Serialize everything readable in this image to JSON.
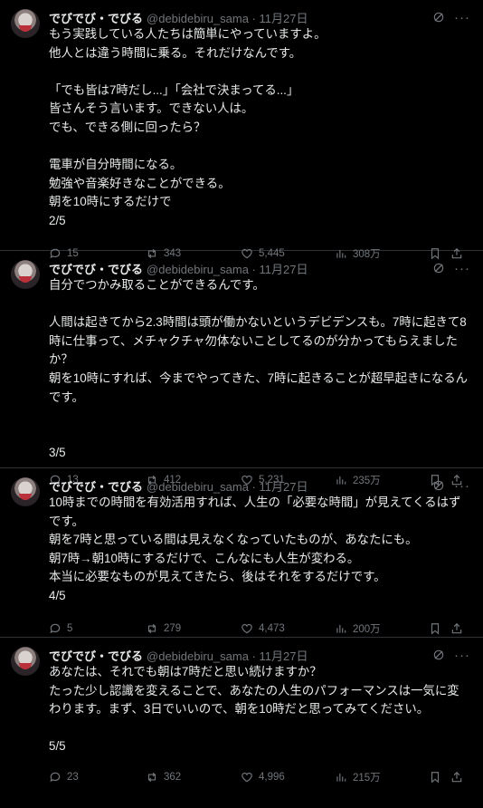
{
  "tweets": [
    {
      "author": "でびでび・でびる",
      "meta": "@debidebiru_sama · 11月27日",
      "text": "もう実践している人たちは簡単にやっていますよ。\n他人とは違う時間に乗る。それだけなんです。\n\n「でも皆は7時だし...」「会社で決まってる...」\n皆さんそう言います。できない人は。\nでも、できる側に回ったら？\n\n電車が自分時間になる。\n勉強や音楽好きなことができる。\n朝を10時にするだけで\n2/5",
      "replies": "15",
      "reposts": "343",
      "likes": "5,445",
      "views": "308万"
    },
    {
      "author": "でびでび・でびる",
      "meta": "@debidebiru_sama · 11月27日",
      "text": "自分でつかみ取ることができるんです。\n\n人間は起きてから2.3時間は頭が働かないというデビデンスも。7時に起きて8時に仕事って、メチャクチャ勿体ないことしてるのが分かってもらえましたか？\n朝を10時にすれば、今までやってきた、7時に起きることが超早起きになるんです。\n\n\n3/5",
      "replies": "13",
      "reposts": "412",
      "likes": "5,231",
      "views": "235万"
    },
    {
      "author": "でびでび・でびる",
      "meta": "@debidebiru_sama · 11月27日",
      "text": "10時までの時間を有効活用すれば、人生の「必要な時間」が見えてくるはずです。\n朝を7時と思っている間は見えなくなっていたものが、あなたにも。\n朝7時→朝10時にするだけで、こんなにも人生が変わる。\n本当に必要なものが見えてきたら、後はそれをするだけです。\n4/5",
      "replies": "5",
      "reposts": "279",
      "likes": "4,473",
      "views": "200万"
    },
    {
      "author": "でびでび・でびる",
      "meta": "@debidebiru_sama · 11月27日",
      "text": "あなたは、それでも朝は7時だと思い続けますか？\nたった少し認識を変えることで、あなたの人生のパフォーマンスは一気に変わります。まず、3日でいいので、朝を10時だと思ってみてください。\n\n5/5",
      "replies": "23",
      "reposts": "362",
      "likes": "4,996",
      "views": "215万"
    }
  ],
  "icons": {
    "more": "more-dots-icon",
    "grok": "grok-icon",
    "reply": "reply-icon",
    "repost": "repost-icon",
    "like": "heart-icon",
    "views": "views-icon",
    "bookmark": "bookmark-icon",
    "share": "share-icon"
  },
  "colors": {
    "background": "#000000",
    "text": "#e7e9ea",
    "muted": "#71767b",
    "divider": "#2f3336"
  }
}
